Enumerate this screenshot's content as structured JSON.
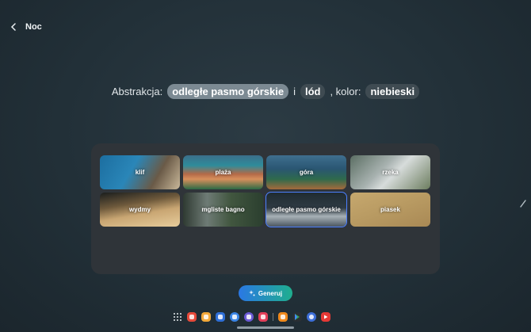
{
  "header": {
    "title": "Noc",
    "back_icon": "chevron-left-icon"
  },
  "prompt": {
    "lead": "Abstrakcja:",
    "chip1": "odległe pasmo górskie",
    "conj": "i",
    "chip2": "lód",
    "sep": ", kolor:",
    "chip3": "niebieski"
  },
  "tiles": [
    {
      "label": "klif"
    },
    {
      "label": "plaża"
    },
    {
      "label": "góra"
    },
    {
      "label": "rzeka"
    },
    {
      "label": "wydmy"
    },
    {
      "label": "mgliste bagno"
    },
    {
      "label": "odległe pasmo górskie",
      "selected": true
    },
    {
      "label": "piasek"
    }
  ],
  "generate": {
    "label": "Generuj",
    "icon": "sparkle-icon"
  },
  "dock": {
    "icons": [
      "apps-grid-icon",
      "flipboard-icon",
      "files-icon",
      "calendar-icon",
      "messages-icon",
      "internet-icon",
      "camera-icon",
      "store-icon",
      "play-store-icon",
      "settings-icon",
      "youtube-icon"
    ],
    "colors": {
      "flipboard": "#e64a3b",
      "files": "#f2a93b",
      "calendar": "#2f6fd6",
      "messages": "#3b86e6",
      "internet": "#6b5ad6",
      "camera": "#e2405a",
      "store": "#f08a1c",
      "settings": "#3d6fd9",
      "youtube": "#e53935"
    }
  },
  "colors": {
    "accent_blue": "#4c80ff",
    "generate_start": "#2a78e4",
    "generate_end": "#1fae8e"
  }
}
